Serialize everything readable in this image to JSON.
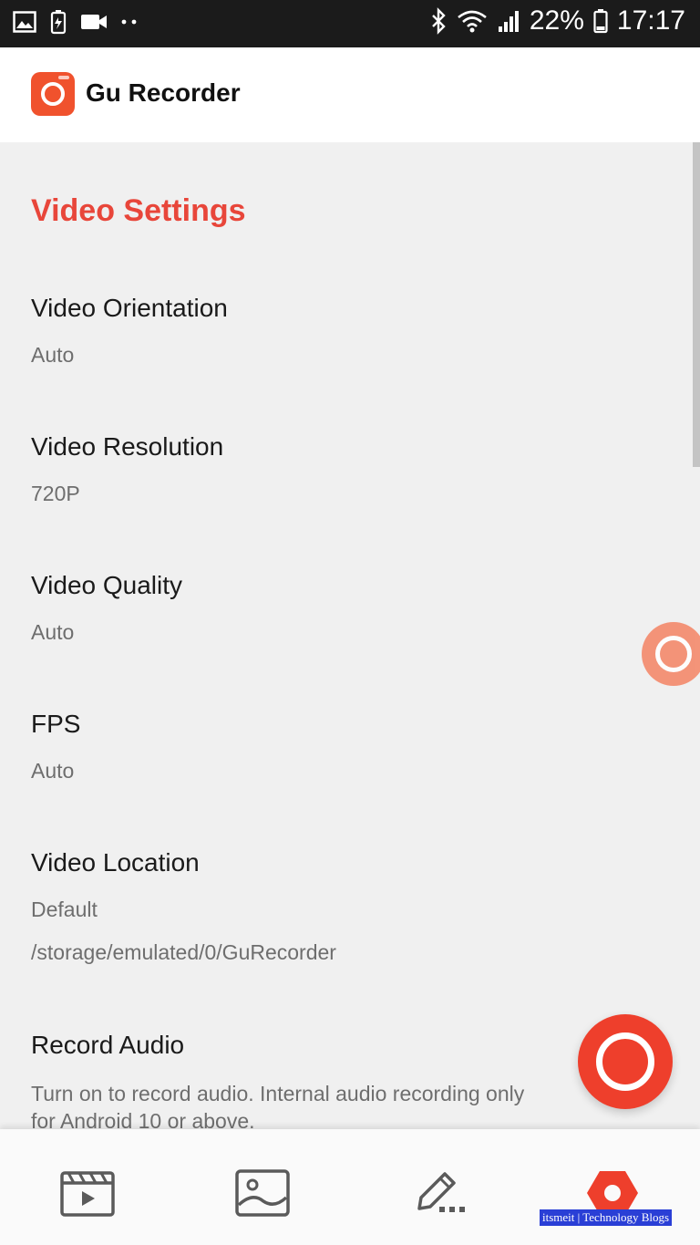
{
  "status_bar": {
    "battery_percent": "22%",
    "time": "17:17",
    "icons": [
      "image-icon",
      "battery-saver-icon",
      "video-camera-icon",
      "more-dots-icon",
      "bluetooth-icon",
      "wifi-icon",
      "signal-icon",
      "battery-icon"
    ]
  },
  "app_bar": {
    "title": "Gu Recorder",
    "logo_icon": "gu-recorder-logo-icon"
  },
  "section": {
    "title": "Video Settings"
  },
  "settings": [
    {
      "label": "Video Orientation",
      "value": "Auto"
    },
    {
      "label": "Video Resolution",
      "value": "720P"
    },
    {
      "label": "Video Quality",
      "value": "Auto"
    },
    {
      "label": "FPS",
      "value": "Auto"
    },
    {
      "label": "Video Location",
      "value": "Default",
      "path": "/storage/emulated/0/GuRecorder"
    },
    {
      "label": "Record Audio",
      "description": "Turn on to record audio. Internal audio recording only for Android 10 or above."
    }
  ],
  "bottom_nav": [
    {
      "icon": "video-list-icon"
    },
    {
      "icon": "image-gallery-icon"
    },
    {
      "icon": "edit-icon"
    },
    {
      "icon": "settings-icon",
      "active": true
    }
  ],
  "watermark": "itsmeit | Technology Blogs",
  "colors": {
    "accent": "#e8463a",
    "fab": "#ee3f2c",
    "background": "#f0f0f0"
  }
}
